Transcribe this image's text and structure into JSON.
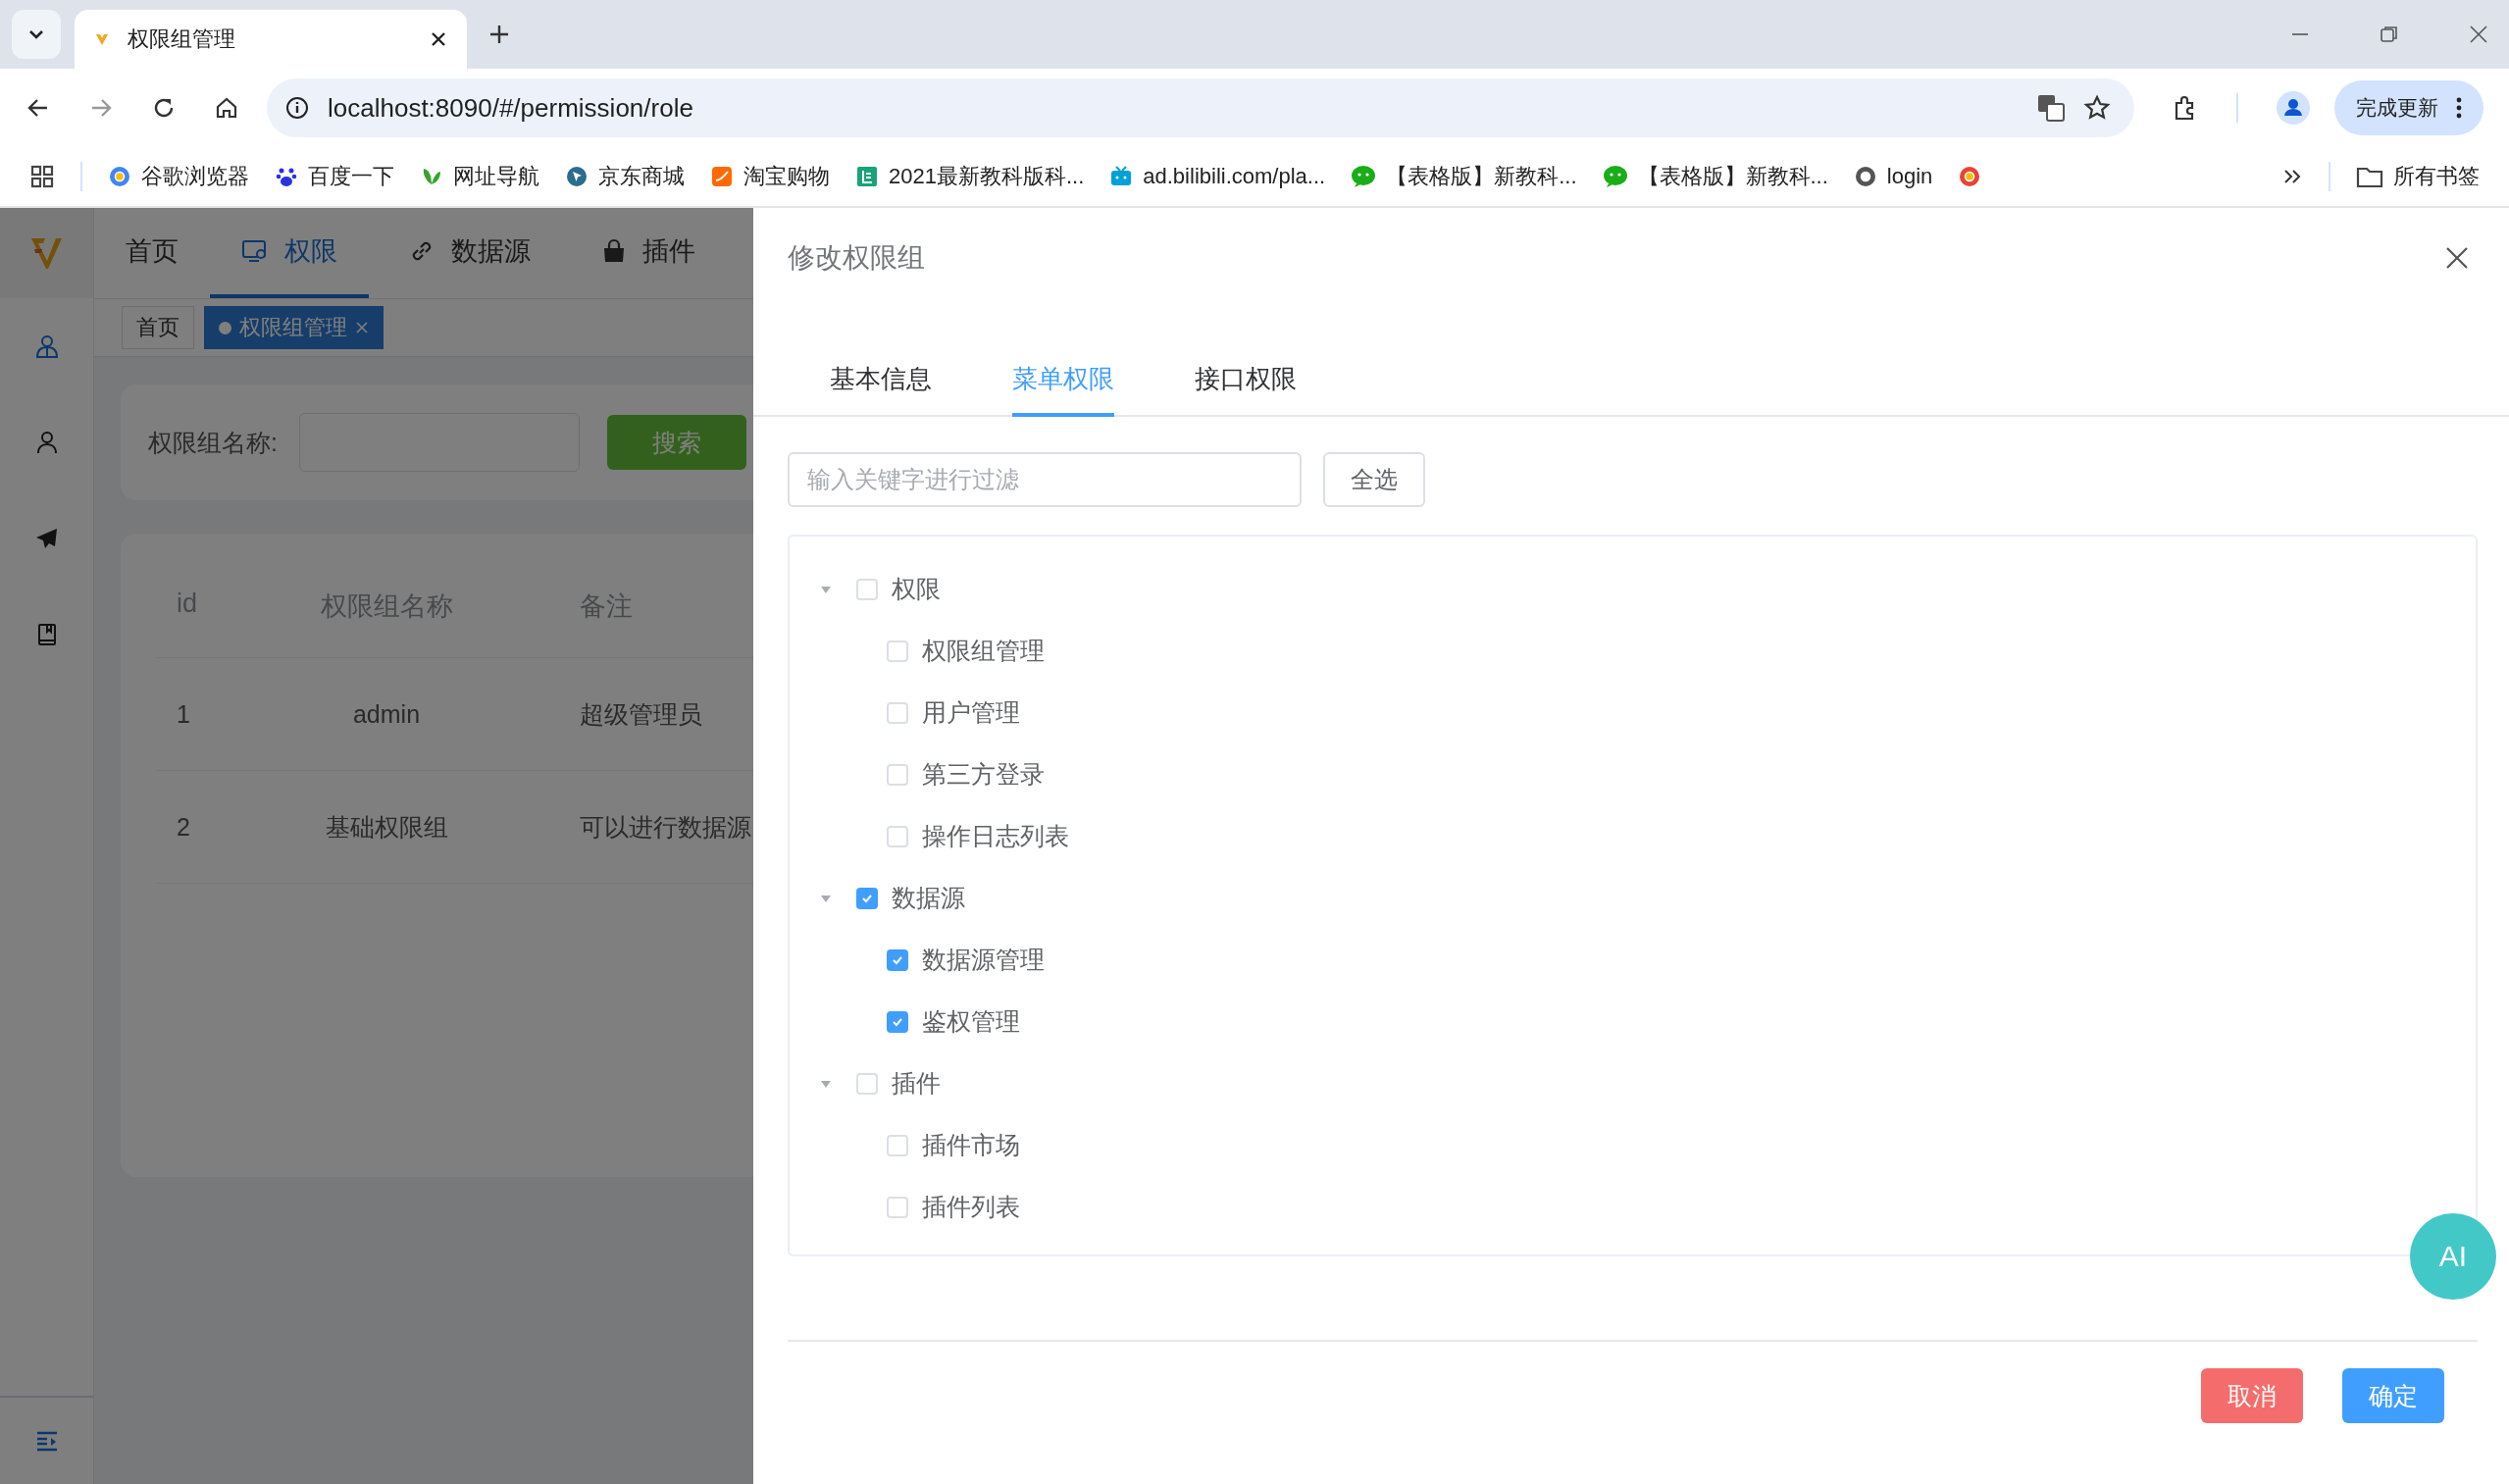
{
  "browser": {
    "tabs": [
      {
        "title": "权限组管理",
        "selected": true
      }
    ],
    "url": "localhost:8090/#/permission/role",
    "update_button": "完成更新",
    "bookmarks": [
      {
        "kind": "chrome",
        "label": "谷歌浏览器"
      },
      {
        "kind": "paw",
        "label": "百度一下"
      },
      {
        "kind": "leaf",
        "label": "网址导航"
      },
      {
        "kind": "cursor",
        "label": "京东商城"
      },
      {
        "kind": "shop",
        "label": "淘宝购物"
      },
      {
        "kind": "book",
        "label": "2021最新教科版科..."
      },
      {
        "kind": "tv",
        "label": "ad.bilibili.com/pla..."
      },
      {
        "kind": "chat",
        "label": "【表格版】新教科..."
      },
      {
        "kind": "chat",
        "label": "【表格版】新教科..."
      },
      {
        "kind": "globe",
        "label": "login"
      },
      {
        "kind": "ring"
      }
    ],
    "all_bookmarks": "所有书签"
  },
  "app": {
    "nav": [
      {
        "kind": "text",
        "label": "首页",
        "selected": false
      },
      {
        "kind": "monitor",
        "label": "权限",
        "selected": true
      },
      {
        "kind": "link",
        "label": "数据源",
        "selected": false
      },
      {
        "kind": "bag",
        "label": "插件",
        "selected": false
      }
    ],
    "side": [
      {
        "kind": "people",
        "selected": true
      },
      {
        "kind": "person",
        "selected": false
      },
      {
        "kind": "plane",
        "selected": false
      },
      {
        "kind": "book",
        "selected": false
      }
    ],
    "tags": [
      {
        "label": "首页",
        "selected": false
      },
      {
        "label": "权限组管理",
        "selected": true
      }
    ],
    "search": {
      "label": "权限组名称:",
      "button": "搜索"
    },
    "table": {
      "columns": [
        "id",
        "权限组名称",
        "备注"
      ],
      "rows": [
        [
          "1",
          "admin",
          "超级管理员"
        ],
        [
          "2",
          "基础权限组",
          "可以进行数据源"
        ]
      ]
    }
  },
  "drawer": {
    "title": "修改权限组",
    "tabs": [
      {
        "label": "基本信息",
        "selected": false
      },
      {
        "label": "菜单权限",
        "selected": true
      },
      {
        "label": "接口权限",
        "selected": false
      }
    ],
    "filter": {
      "placeholder": "输入关键字进行过滤"
    },
    "select_all": "全选",
    "tree": [
      {
        "label": "权限",
        "checked": false,
        "expanded": true,
        "children": [
          {
            "label": "权限组管理",
            "checked": false
          },
          {
            "label": "用户管理",
            "checked": false
          },
          {
            "label": "第三方登录",
            "checked": false
          },
          {
            "label": "操作日志列表",
            "checked": false
          }
        ]
      },
      {
        "label": "数据源",
        "checked": true,
        "expanded": true,
        "children": [
          {
            "label": "数据源管理",
            "checked": true
          },
          {
            "label": "鉴权管理",
            "checked": true
          }
        ]
      },
      {
        "label": "插件",
        "checked": false,
        "expanded": true,
        "children": [
          {
            "label": "插件市场",
            "checked": false
          },
          {
            "label": "插件列表",
            "checked": false
          }
        ]
      }
    ],
    "cancel": "取消",
    "confirm": "确定",
    "ai_button": "AI"
  }
}
